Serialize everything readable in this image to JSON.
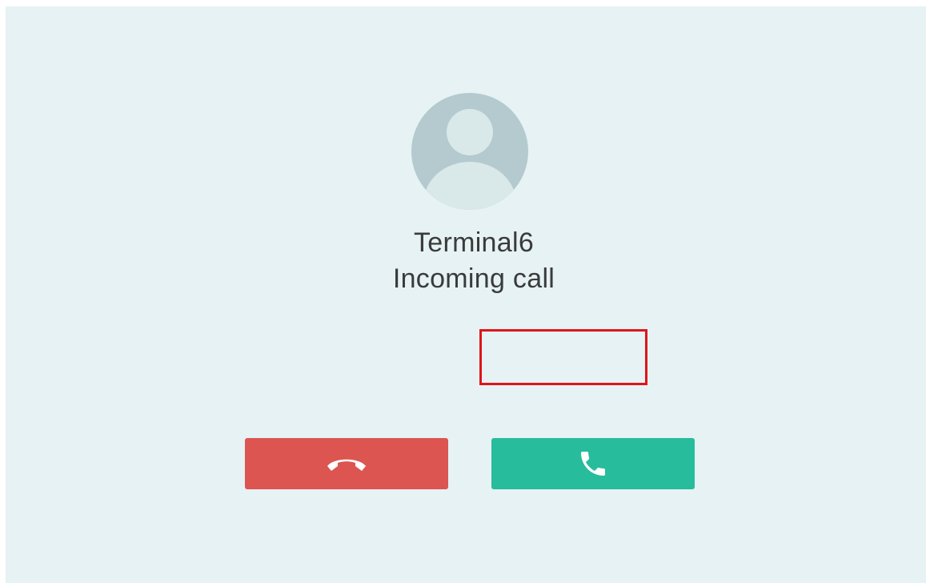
{
  "caller": {
    "name": "Terminal6",
    "status": "Incoming call",
    "avatar_icon": "person-placeholder-icon"
  },
  "actions": {
    "decline_icon": "hang-up-icon",
    "accept_icon": "phone-icon"
  },
  "colors": {
    "background": "#e6f2f4",
    "decline": "#dc5550",
    "accept": "#27bc9c",
    "highlight": "#e0141b",
    "avatar": "#b4cace"
  }
}
